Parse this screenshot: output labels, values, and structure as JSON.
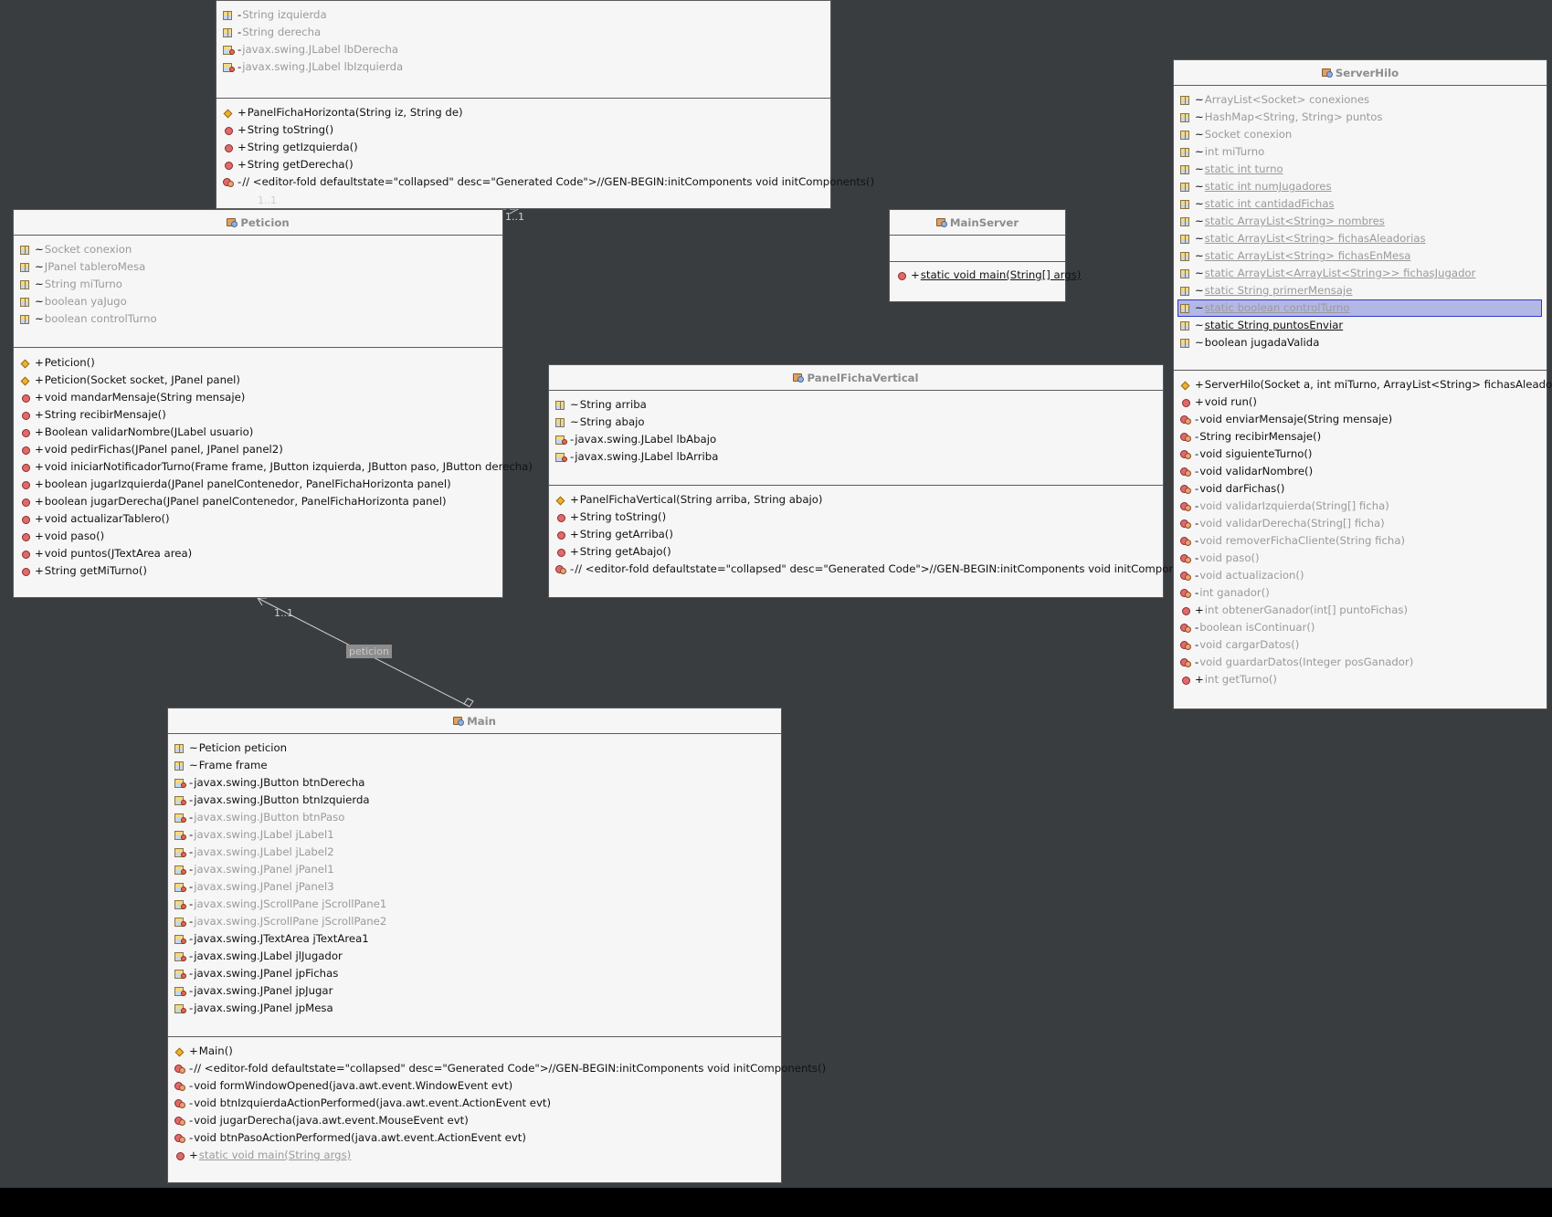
{
  "classes": {
    "panel_ficha_horizonta": {
      "name": "",
      "attributes": [
        {
          "vis": "-",
          "text": "String izquierda",
          "icon": "field",
          "dim": true
        },
        {
          "vis": "-",
          "text": "String derecha",
          "icon": "field",
          "dim": true
        },
        {
          "vis": "-",
          "text": "javax.swing.JLabel lbDerecha",
          "icon": "fieldp",
          "dim": true
        },
        {
          "vis": "-",
          "text": "javax.swing.JLabel lbIzquierda",
          "icon": "fieldp",
          "dim": true
        }
      ],
      "operations": [
        {
          "vis": "+",
          "text": "PanelFichaHorizonta(String iz, String de)",
          "icon": "ctor"
        },
        {
          "vis": "+",
          "text": "String toString()",
          "icon": "method"
        },
        {
          "vis": "+",
          "text": "String getIzquierda()",
          "icon": "method"
        },
        {
          "vis": "+",
          "text": "String getDerecha()",
          "icon": "method"
        },
        {
          "vis": "-",
          "text": "// <editor-fold defaultstate=\"collapsed\" desc=\"Generated Code\">//GEN-BEGIN:initComponents void initComponents()",
          "icon": "methodp"
        }
      ]
    },
    "peticion": {
      "name": "Peticion",
      "attributes": [
        {
          "vis": "~",
          "text": "Socket conexion",
          "icon": "field",
          "dim": true
        },
        {
          "vis": "~",
          "text": "JPanel tableroMesa",
          "icon": "field",
          "dim": true
        },
        {
          "vis": "~",
          "text": "String miTurno",
          "icon": "field",
          "dim": true
        },
        {
          "vis": "~",
          "text": "boolean yaJugo",
          "icon": "field",
          "dim": true
        },
        {
          "vis": "~",
          "text": "boolean controlTurno",
          "icon": "field",
          "dim": true
        }
      ],
      "operations": [
        {
          "vis": "+",
          "text": "Peticion()",
          "icon": "ctor"
        },
        {
          "vis": "+",
          "text": "Peticion(Socket socket, JPanel panel)",
          "icon": "ctor"
        },
        {
          "vis": "+",
          "text": "void mandarMensaje(String mensaje)",
          "icon": "method"
        },
        {
          "vis": "+",
          "text": "String recibirMensaje()",
          "icon": "method"
        },
        {
          "vis": "+",
          "text": "Boolean validarNombre(JLabel usuario)",
          "icon": "method"
        },
        {
          "vis": "+",
          "text": "void pedirFichas(JPanel panel, JPanel panel2)",
          "icon": "method"
        },
        {
          "vis": "+",
          "text": "void iniciarNotificadorTurno(Frame frame, JButton izquierda, JButton paso, JButton derecha)",
          "icon": "method"
        },
        {
          "vis": "+",
          "text": "boolean jugarIzquierda(JPanel panelContenedor, PanelFichaHorizonta panel)",
          "icon": "method"
        },
        {
          "vis": "+",
          "text": "boolean jugarDerecha(JPanel panelContenedor, PanelFichaHorizonta panel)",
          "icon": "method"
        },
        {
          "vis": "+",
          "text": "void actualizarTablero()",
          "icon": "method"
        },
        {
          "vis": "+",
          "text": "void paso()",
          "icon": "method"
        },
        {
          "vis": "+",
          "text": "void puntos(JTextArea area)",
          "icon": "method"
        },
        {
          "vis": "+",
          "text": "String getMiTurno()",
          "icon": "method"
        }
      ]
    },
    "main_server": {
      "name": "MainServer",
      "attributes": [],
      "operations": [
        {
          "vis": "+",
          "text": "static void main(String[] args)",
          "icon": "method",
          "underline": true
        }
      ]
    },
    "panel_ficha_vertical": {
      "name": "PanelFichaVertical",
      "attributes": [
        {
          "vis": "~",
          "text": "String arriba",
          "icon": "field"
        },
        {
          "vis": "~",
          "text": "String abajo",
          "icon": "field"
        },
        {
          "vis": "-",
          "text": "javax.swing.JLabel lbAbajo",
          "icon": "fieldp"
        },
        {
          "vis": "-",
          "text": "javax.swing.JLabel lbArriba",
          "icon": "fieldp"
        }
      ],
      "operations": [
        {
          "vis": "+",
          "text": "PanelFichaVertical(String arriba, String abajo)",
          "icon": "ctor"
        },
        {
          "vis": "+",
          "text": "String toString()",
          "icon": "method"
        },
        {
          "vis": "+",
          "text": "String getArriba()",
          "icon": "method"
        },
        {
          "vis": "+",
          "text": "String getAbajo()",
          "icon": "method"
        },
        {
          "vis": "-",
          "text": "// <editor-fold defaultstate=\"collapsed\" desc=\"Generated Code\">//GEN-BEGIN:initComponents void initComponents()",
          "icon": "methodp"
        }
      ]
    },
    "server_hilo": {
      "name": "ServerHilo",
      "attributes": [
        {
          "vis": "~",
          "text": "ArrayList<Socket> conexiones",
          "icon": "field",
          "dim": true
        },
        {
          "vis": "~",
          "text": "HashMap<String, String> puntos",
          "icon": "field",
          "dim": true
        },
        {
          "vis": "~",
          "text": "Socket conexion",
          "icon": "field",
          "dim": true
        },
        {
          "vis": "~",
          "text": "int miTurno",
          "icon": "field",
          "dim": true
        },
        {
          "vis": "~",
          "text": "static int turno",
          "icon": "field",
          "dim": true,
          "underline": true
        },
        {
          "vis": "~",
          "text": "static int numJugadores",
          "icon": "field",
          "dim": true,
          "underline": true
        },
        {
          "vis": "~",
          "text": "static int cantidadFichas",
          "icon": "field",
          "dim": true,
          "underline": true
        },
        {
          "vis": "~",
          "text": "static ArrayList<String> nombres",
          "icon": "field",
          "dim": true,
          "underline": true
        },
        {
          "vis": "~",
          "text": "static ArrayList<String> fichasAleadorias",
          "icon": "field",
          "dim": true,
          "underline": true
        },
        {
          "vis": "~",
          "text": "static ArrayList<String> fichasEnMesa",
          "icon": "field",
          "dim": true,
          "underline": true
        },
        {
          "vis": "~",
          "text": "static ArrayList<ArrayList<String>> fichasJugador",
          "icon": "field",
          "dim": true,
          "underline": true
        },
        {
          "vis": "~",
          "text": "static String primerMensaje",
          "icon": "field",
          "dim": true,
          "underline": true
        },
        {
          "vis": "~",
          "text": "static boolean controlTurno",
          "icon": "field",
          "dim": true,
          "underline": true,
          "selected": true
        },
        {
          "vis": "~",
          "text": "static String puntosEnviar",
          "icon": "field",
          "underline": true
        },
        {
          "vis": "~",
          "text": "boolean jugadaValida",
          "icon": "field"
        }
      ],
      "operations": [
        {
          "vis": "+",
          "text": "ServerHilo(Socket a, int miTurno, ArrayList<String> fichasAleadorias)",
          "icon": "ctor"
        },
        {
          "vis": "+",
          "text": "void run()",
          "icon": "method"
        },
        {
          "vis": "-",
          "text": "void enviarMensaje(String mensaje)",
          "icon": "methodp"
        },
        {
          "vis": "-",
          "text": "String recibirMensaje()",
          "icon": "methodp"
        },
        {
          "vis": "-",
          "text": "void siguienteTurno()",
          "icon": "methodp"
        },
        {
          "vis": "-",
          "text": "void validarNombre()",
          "icon": "methodp"
        },
        {
          "vis": "-",
          "text": "void darFichas()",
          "icon": "methodp"
        },
        {
          "vis": "-",
          "text": "void validarIzquierda(String[] ficha)",
          "icon": "methodp",
          "dim": true
        },
        {
          "vis": "-",
          "text": "void validarDerecha(String[] ficha)",
          "icon": "methodp",
          "dim": true
        },
        {
          "vis": "-",
          "text": "void removerFichaCliente(String ficha)",
          "icon": "methodp",
          "dim": true
        },
        {
          "vis": "-",
          "text": "void paso()",
          "icon": "methodp",
          "dim": true
        },
        {
          "vis": "-",
          "text": "void actualizacion()",
          "icon": "methodp",
          "dim": true
        },
        {
          "vis": "-",
          "text": "int ganador()",
          "icon": "methodp",
          "dim": true
        },
        {
          "vis": "+",
          "text": "int obtenerGanador(int[] puntoFichas)",
          "icon": "method",
          "dim": true
        },
        {
          "vis": "-",
          "text": "boolean isContinuar()",
          "icon": "methodp",
          "dim": true
        },
        {
          "vis": "-",
          "text": "void cargarDatos()",
          "icon": "methodp",
          "dim": true
        },
        {
          "vis": "-",
          "text": "void guardarDatos(Integer posGanador)",
          "icon": "methodp",
          "dim": true
        },
        {
          "vis": "+",
          "text": "int getTurno()",
          "icon": "method",
          "dim": true
        }
      ]
    },
    "main": {
      "name": "Main",
      "attributes": [
        {
          "vis": "~",
          "text": "Peticion peticion",
          "icon": "field"
        },
        {
          "vis": "~",
          "text": "Frame frame",
          "icon": "field"
        },
        {
          "vis": "-",
          "text": "javax.swing.JButton btnDerecha",
          "icon": "fieldp"
        },
        {
          "vis": "-",
          "text": "javax.swing.JButton btnIzquierda",
          "icon": "fieldp"
        },
        {
          "vis": "-",
          "text": "javax.swing.JButton btnPaso",
          "icon": "fieldp",
          "dim": true
        },
        {
          "vis": "-",
          "text": "javax.swing.JLabel jLabel1",
          "icon": "fieldp",
          "dim": true
        },
        {
          "vis": "-",
          "text": "javax.swing.JLabel jLabel2",
          "icon": "fieldp",
          "dim": true
        },
        {
          "vis": "-",
          "text": "javax.swing.JPanel jPanel1",
          "icon": "fieldp",
          "dim": true
        },
        {
          "vis": "-",
          "text": "javax.swing.JPanel jPanel3",
          "icon": "fieldp",
          "dim": true
        },
        {
          "vis": "-",
          "text": "javax.swing.JScrollPane jScrollPane1",
          "icon": "fieldp",
          "dim": true
        },
        {
          "vis": "-",
          "text": "javax.swing.JScrollPane jScrollPane2",
          "icon": "fieldp",
          "dim": true
        },
        {
          "vis": "-",
          "text": "javax.swing.JTextArea jTextArea1",
          "icon": "fieldp"
        },
        {
          "vis": "-",
          "text": "javax.swing.JLabel jlJugador",
          "icon": "fieldp"
        },
        {
          "vis": "-",
          "text": "javax.swing.JPanel jpFichas",
          "icon": "fieldp"
        },
        {
          "vis": "-",
          "text": "javax.swing.JPanel jpJugar",
          "icon": "fieldp"
        },
        {
          "vis": "-",
          "text": "javax.swing.JPanel jpMesa",
          "icon": "fieldp"
        }
      ],
      "operations": [
        {
          "vis": "+",
          "text": "Main()",
          "icon": "ctor"
        },
        {
          "vis": "-",
          "text": "// <editor-fold defaultstate=\"collapsed\" desc=\"Generated Code\">//GEN-BEGIN:initComponents void initComponents()",
          "icon": "methodp"
        },
        {
          "vis": "-",
          "text": "void formWindowOpened(java.awt.event.WindowEvent evt)",
          "icon": "methodp"
        },
        {
          "vis": "-",
          "text": "void btnIzquierdaActionPerformed(java.awt.event.ActionEvent evt)",
          "icon": "methodp"
        },
        {
          "vis": "-",
          "text": "void jugarDerecha(java.awt.event.MouseEvent evt)",
          "icon": "methodp"
        },
        {
          "vis": "-",
          "text": "void btnPasoActionPerformed(java.awt.event.ActionEvent evt)",
          "icon": "methodp"
        },
        {
          "vis": "+",
          "text": "static void main(String args)",
          "icon": "method",
          "dim": true,
          "underline": true
        }
      ]
    }
  },
  "links": {
    "dep_mult_left": "1..1",
    "dep_mult_right": "1..1",
    "assoc_mult": "1..1",
    "assoc_label": "peticion"
  },
  "colors": {
    "background": "#3a3d40",
    "class_fill": "#f6f6f6",
    "dim_text": "#9a9a9a",
    "selection": "#b3b7e6"
  }
}
